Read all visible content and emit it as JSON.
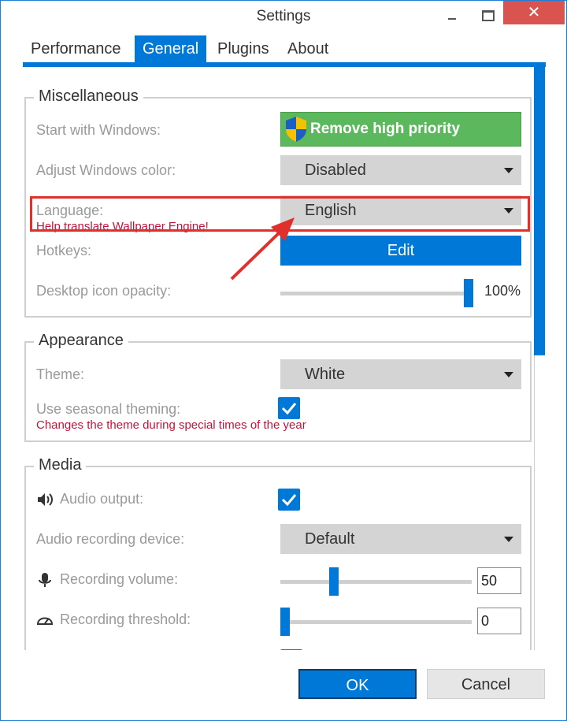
{
  "window": {
    "title": "Settings"
  },
  "tabs": [
    {
      "label": "Performance"
    },
    {
      "label": "General"
    },
    {
      "label": "Plugins"
    },
    {
      "label": "About"
    }
  ],
  "miscellaneous": {
    "legend": "Miscellaneous",
    "start_with_windows": {
      "label": "Start with Windows:",
      "button_label": "Remove high priority"
    },
    "adjust_color": {
      "label": "Adjust Windows color:",
      "value": "Disabled"
    },
    "language": {
      "label": "Language:",
      "hint": "Help translate Wallpaper Engine!",
      "value": "English"
    },
    "hotkeys": {
      "label": "Hotkeys:",
      "button_label": "Edit"
    },
    "desktop_icon_opacity": {
      "label": "Desktop icon opacity:",
      "value": "100%",
      "level": 1.0
    }
  },
  "appearance": {
    "legend": "Appearance",
    "theme": {
      "label": "Theme:",
      "value": "White"
    },
    "seasonal": {
      "label": "Use seasonal theming:",
      "hint": "Changes the theme during special times of the year",
      "checked": true
    }
  },
  "media": {
    "legend": "Media",
    "audio_output": {
      "label": "Audio output:",
      "checked": true
    },
    "recording_device": {
      "label": "Audio recording device:",
      "value": "Default"
    },
    "recording_volume": {
      "label": "Recording volume:",
      "value": "50",
      "level": 0.27
    },
    "recording_threshold": {
      "label": "Recording threshold:",
      "value": "0",
      "level": 0.0
    }
  },
  "footer": {
    "ok_label": "OK",
    "cancel_label": "Cancel"
  },
  "icons": {
    "close": "close-icon",
    "shield": "uac-shield-icon",
    "speaker": "speaker-icon",
    "microphone": "microphone-icon",
    "gauge": "gauge-icon"
  },
  "colors": {
    "accent": "#0078d7",
    "green": "#5cb85c",
    "hint": "#c0143c",
    "highlight": "#e0302b"
  }
}
